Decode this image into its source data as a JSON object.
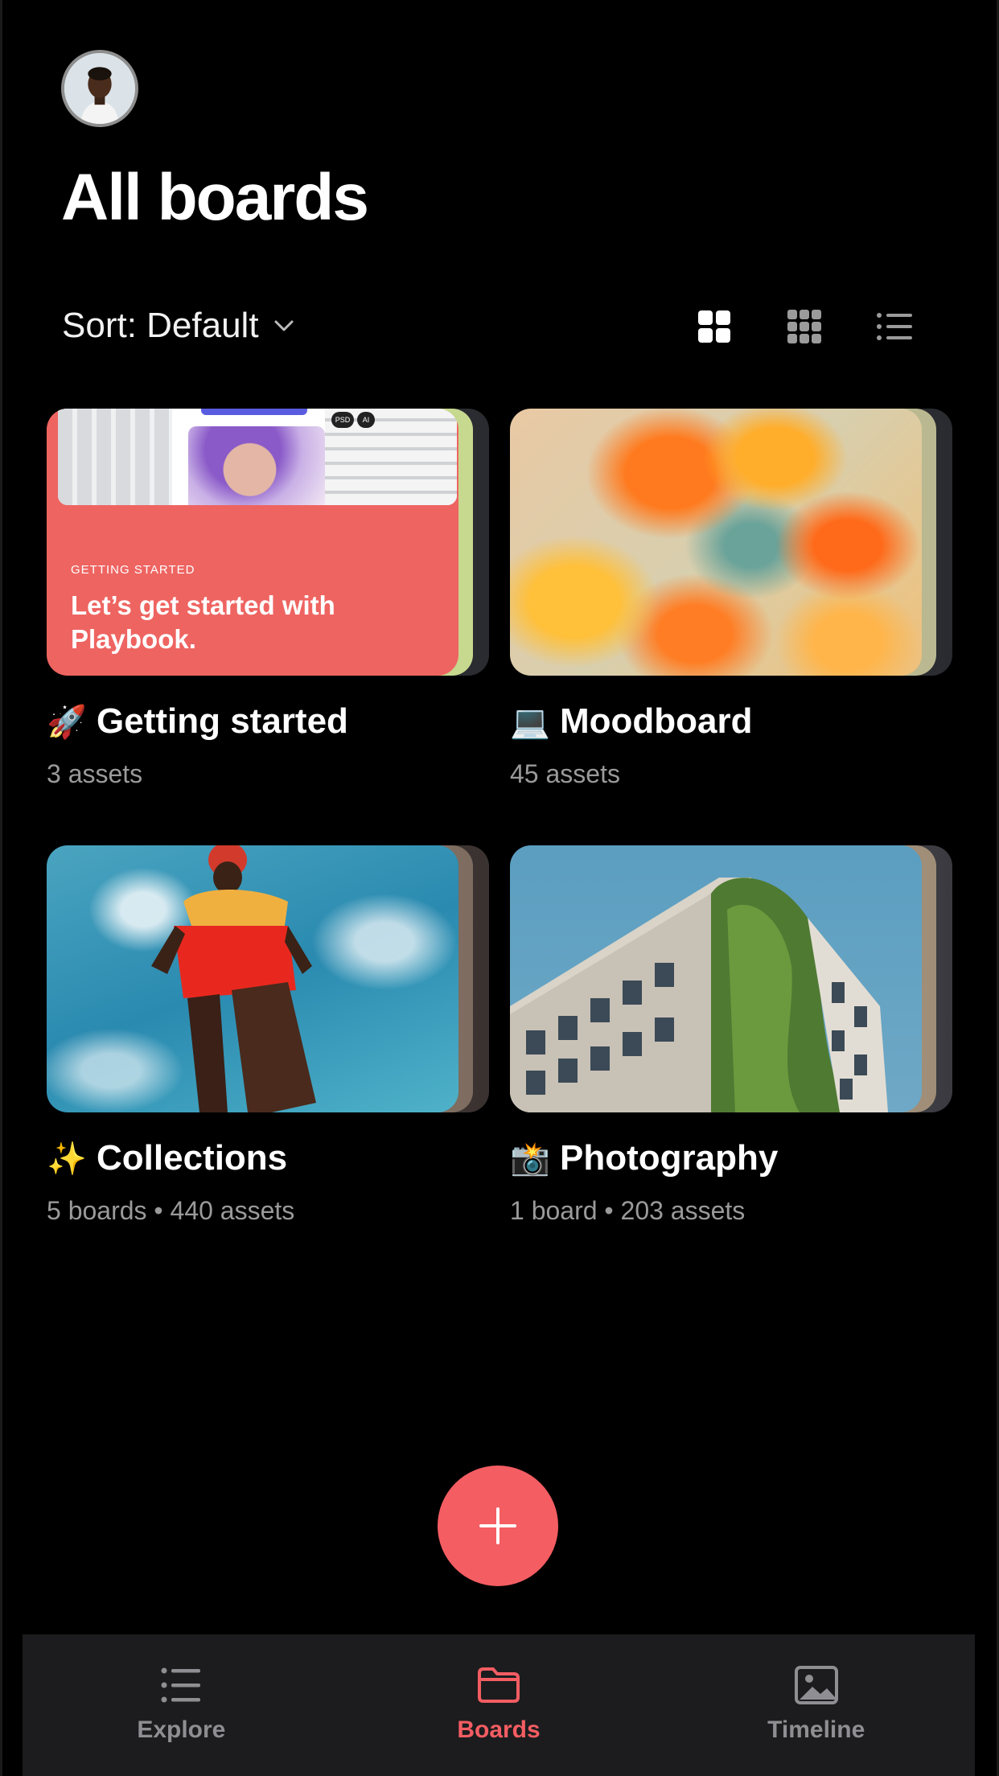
{
  "header": {
    "title": "All boards",
    "sort_label": "Sort: Default"
  },
  "view_modes": [
    "large-grid",
    "small-grid",
    "list"
  ],
  "boards": [
    {
      "emoji": "🚀",
      "title": "Getting started",
      "meta": "3 assets",
      "thumbnail": {
        "eyebrow": "GETTING STARTED",
        "headline": "Let’s get started with Playbook.",
        "pill_1": "PSD",
        "pill_2": "AI"
      }
    },
    {
      "emoji": "💻",
      "title": "Moodboard",
      "meta": "45 assets"
    },
    {
      "emoji": "✨",
      "title": "Collections",
      "meta": "5 boards • 440 assets"
    },
    {
      "emoji": "📸",
      "title": "Photography",
      "meta": "1 board • 203 assets"
    }
  ],
  "tabbar": {
    "items": [
      {
        "label": "Explore",
        "icon": "list-icon"
      },
      {
        "label": "Boards",
        "icon": "folder-icon",
        "active": true
      },
      {
        "label": "Timeline",
        "icon": "image-icon"
      }
    ]
  },
  "colors": {
    "accent": "#f45d62",
    "background": "#000000",
    "tabbar": "#1c1c1e",
    "muted_text": "#9a9a9a"
  }
}
